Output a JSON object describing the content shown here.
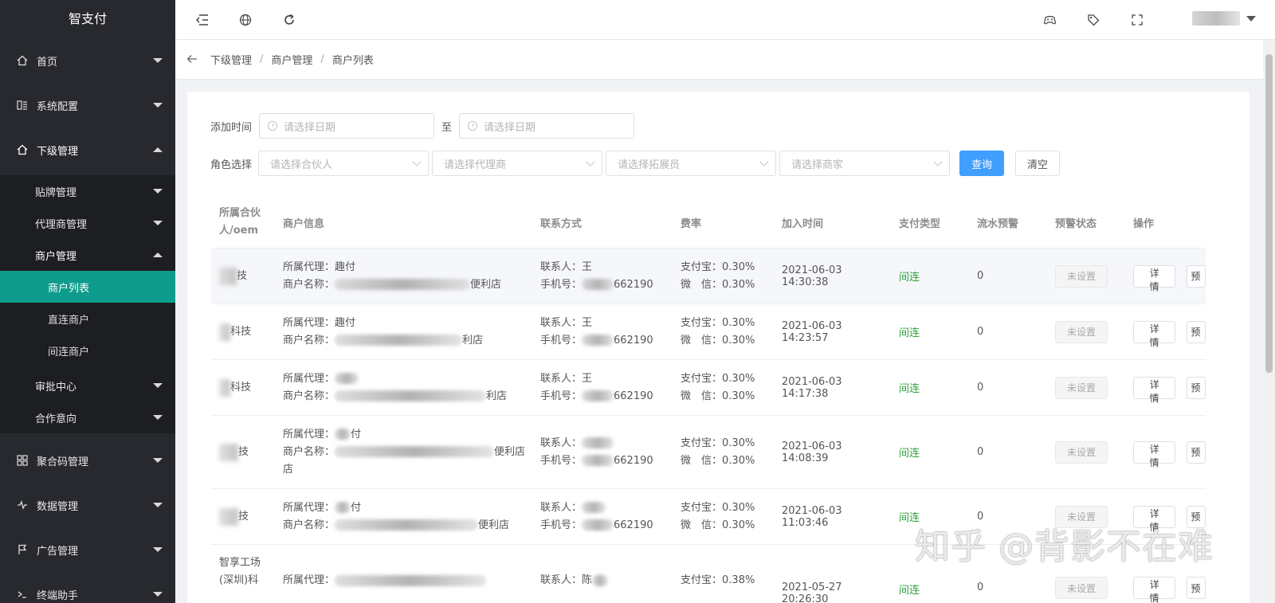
{
  "app": {
    "title": "智支付"
  },
  "sidebar": {
    "items": [
      {
        "label": "首页",
        "icon": "home-icon"
      },
      {
        "label": "系统配置",
        "icon": "settings-grid-icon"
      },
      {
        "label": "下级管理",
        "icon": "home-icon"
      },
      {
        "label": "聚合码管理",
        "icon": "apps-icon"
      },
      {
        "label": "数据管理",
        "icon": "pulse-icon"
      },
      {
        "label": "广告管理",
        "icon": "flag-icon"
      },
      {
        "label": "终端助手",
        "icon": "terminal-icon"
      }
    ],
    "sub": {
      "tiepai": "贴牌管理",
      "daili": "代理商管理",
      "shanghu": "商户管理",
      "shanghu_list": "商户列表",
      "zhilian": "直连商户",
      "jianlian": "间连商户",
      "shenpi": "审批中心",
      "hezuo": "合作意向"
    }
  },
  "breadcrumb": [
    "下级管理",
    "商户管理",
    "商户列表"
  ],
  "filters": {
    "date_label": "添加时间",
    "date_placeholder": "请选择日期",
    "to_label": "至",
    "role_label": "角色选择",
    "partner_placeholder": "请选择合伙人",
    "agent_placeholder": "请选择代理商",
    "expander_placeholder": "请选择拓展员",
    "merchant_placeholder": "请选择商家",
    "query_label": "查询",
    "clear_label": "清空"
  },
  "table": {
    "headers": [
      "所属合伙人/oem",
      "商户信息",
      "联系方式",
      "费率",
      "加入时间",
      "支付类型",
      "流水预警",
      "预警状态",
      "操作"
    ],
    "agent_prefix": "所属代理：",
    "name_prefix": "商户名称：",
    "contact_prefix": "联系人：",
    "phone_prefix": "手机号：",
    "alipay_prefix": "支付宝：",
    "wechat_prefix": "微　信：",
    "detail_label": "详情",
    "warn_btn_label": "预",
    "rows": [
      {
        "partner": "技",
        "agent": "趣付",
        "name": "便利店",
        "contact": "王",
        "phone": "662190",
        "alipay": "0.30%",
        "wechat": "0.30%",
        "time": "2021-06-03 14:30:38",
        "type": "间连",
        "flow": "0",
        "status": "未设置"
      },
      {
        "partner": "科技",
        "agent": "趣付",
        "name": "利店",
        "contact": "王",
        "phone": "662190",
        "alipay": "0.30%",
        "wechat": "0.30%",
        "time": "2021-06-03 14:23:57",
        "type": "间连",
        "flow": "0",
        "status": "未设置"
      },
      {
        "partner": "科技",
        "agent": "",
        "name": "利店",
        "contact": "王",
        "phone": "662190",
        "alipay": "0.30%",
        "wechat": "0.30%",
        "time": "2021-06-03 14:17:38",
        "type": "间连",
        "flow": "0",
        "status": "未设置"
      },
      {
        "partner": "技",
        "agent": "付",
        "name": "便利店",
        "name_cont": "店",
        "contact": "",
        "phone": "662190",
        "alipay": "0.30%",
        "wechat": "0.30%",
        "time": "2021-06-03 14:08:39",
        "type": "间连",
        "flow": "0",
        "status": "未设置"
      },
      {
        "partner": "技",
        "agent": "付",
        "name": "便利店",
        "contact": "",
        "phone": "662190",
        "alipay": "0.30%",
        "wechat": "0.30%",
        "time": "2021-06-03 11:03:46",
        "type": "间连",
        "flow": "0",
        "status": "未设置"
      },
      {
        "partner": "智享工场(深圳)科",
        "agent": "",
        "name": "",
        "contact": "陈",
        "phone": "",
        "alipay": "0.38%",
        "wechat": "",
        "time": "2021-05-27 20:26:30",
        "type": "间连",
        "flow": "0",
        "status": "未设置"
      }
    ]
  },
  "watermark": "知乎 @背影不在难",
  "colors": {
    "sidebar_bg": "#28292e",
    "active": "#0e9c8c",
    "primary": "#409eff",
    "paytype": "#2e9f3e"
  }
}
